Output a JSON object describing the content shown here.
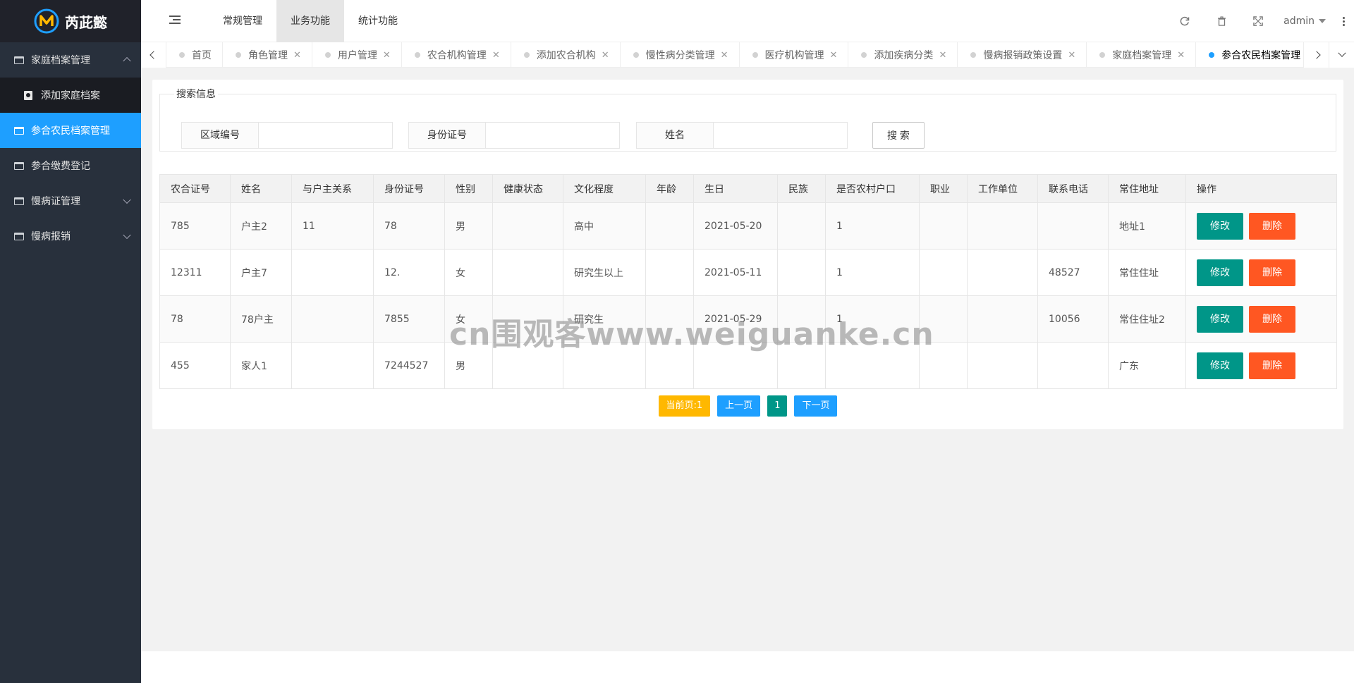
{
  "logo": {
    "text": "芮茈懿"
  },
  "sidebar": {
    "items": [
      {
        "label": "家庭档案管理",
        "expanded": true,
        "sub": [
          {
            "label": "添加家庭档案"
          }
        ]
      },
      {
        "label": "参合农民档案管理",
        "active": true
      },
      {
        "label": "参合缴费登记"
      },
      {
        "label": "慢病证管理",
        "has_children": true
      },
      {
        "label": "慢病报销",
        "has_children": true
      }
    ]
  },
  "header": {
    "nav": [
      {
        "label": "常规管理"
      },
      {
        "label": "业务功能",
        "active": true
      },
      {
        "label": "统计功能"
      }
    ],
    "user": "admin"
  },
  "tabs": [
    {
      "label": "首页",
      "closable": false
    },
    {
      "label": "角色管理",
      "closable": true
    },
    {
      "label": "用户管理",
      "closable": true
    },
    {
      "label": "农合机构管理",
      "closable": true
    },
    {
      "label": "添加农合机构",
      "closable": true
    },
    {
      "label": "慢性病分类管理",
      "closable": true
    },
    {
      "label": "医疗机构管理",
      "closable": true
    },
    {
      "label": "添加疾病分类",
      "closable": true
    },
    {
      "label": "慢病报销政策设置",
      "closable": true
    },
    {
      "label": "家庭档案管理",
      "closable": true
    },
    {
      "label": "参合农民档案管理",
      "closable": true,
      "active": true
    }
  ],
  "search": {
    "legend": "搜索信息",
    "fields": [
      {
        "label": "区域编号",
        "value": ""
      },
      {
        "label": "身份证号",
        "value": ""
      },
      {
        "label": "姓名",
        "value": ""
      }
    ],
    "button": "搜 索"
  },
  "table": {
    "columns": [
      "农合证号",
      "姓名",
      "与户主关系",
      "身份证号",
      "性别",
      "健康状态",
      "文化程度",
      "年龄",
      "生日",
      "民族",
      "是否农村户口",
      "职业",
      "工作单位",
      "联系电话",
      "常住地址",
      "操作"
    ],
    "rows": [
      [
        "785",
        "户主2",
        "11",
        "78",
        "男",
        "",
        "高中",
        "",
        "2021-05-20",
        "",
        "1",
        "",
        "",
        "",
        "地址1"
      ],
      [
        "12311",
        "户主7",
        "",
        "12.",
        "女",
        "",
        "研究生以上",
        "",
        "2021-05-11",
        "",
        "1",
        "",
        "",
        "48527",
        "常住住址"
      ],
      [
        "78",
        "78户主",
        "",
        "7855",
        "女",
        "",
        "研究生",
        "",
        "2021-05-29",
        "",
        "1",
        "",
        "",
        "10056",
        "常住住址2"
      ],
      [
        "455",
        "家人1",
        "",
        "7244527",
        "男",
        "",
        "",
        "",
        "",
        "",
        "",
        "",
        "",
        "",
        "广东"
      ]
    ],
    "edit_label": "修改",
    "delete_label": "删除"
  },
  "pager": {
    "current_label": "当前页:1",
    "prev_label": "上一页",
    "page": "1",
    "next_label": "下一页"
  },
  "watermark": "cn围观客www.weiguanke.cn",
  "colors": {
    "sidebar_bg": "#28303c",
    "active_blue": "#1e9fff",
    "edit_green": "#009688",
    "delete_orange": "#ff5722",
    "pager_yellow": "#ffb800"
  }
}
